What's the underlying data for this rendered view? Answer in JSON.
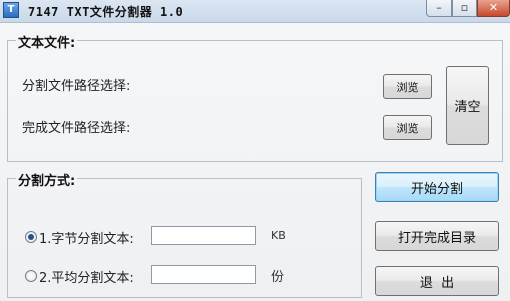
{
  "window": {
    "title": "7147 TXT文件分割器 1.0",
    "app_icon_glyph": "T",
    "controls": {
      "minimize": "–",
      "maximize": "▫",
      "close": "✕"
    }
  },
  "file_group": {
    "title": "文本文件:",
    "split_path_label": "分割文件路径选择:",
    "done_path_label": "完成文件路径选择:",
    "browse_label_1": "浏览",
    "browse_label_2": "浏览",
    "clear_label": "清空"
  },
  "mode_group": {
    "title": "分割方式:",
    "option_bytes": {
      "label": "1.字节分割文本:",
      "value": "",
      "unit": "KB",
      "checked": true
    },
    "option_avg": {
      "label": "2.平均分割文本:",
      "value": "",
      "unit": "份",
      "checked": false
    }
  },
  "actions": {
    "start_label": "开始分割",
    "open_dir_label": "打开完成目录",
    "exit_label": "退  出"
  }
}
